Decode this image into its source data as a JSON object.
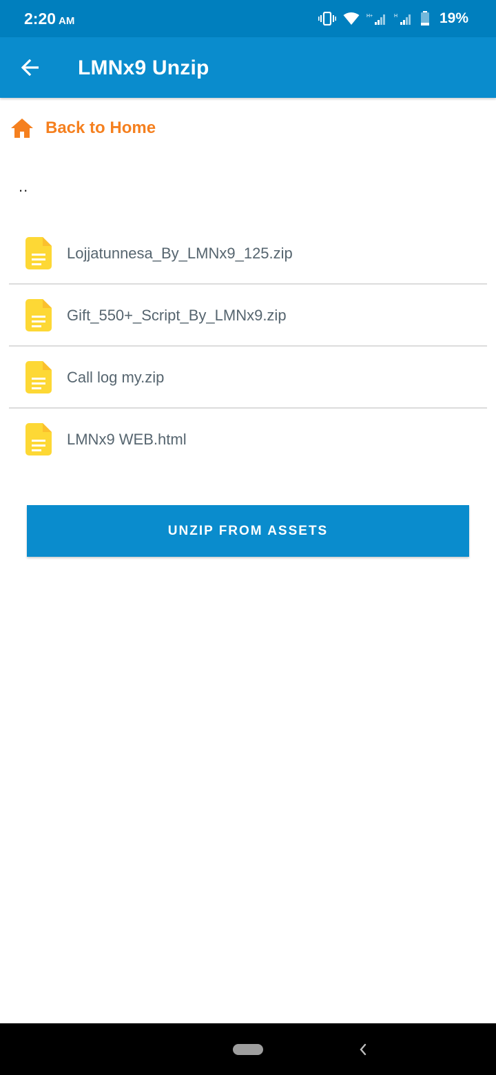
{
  "status_bar": {
    "time": "2:20",
    "ampm": "AM",
    "battery": "19%",
    "icons": [
      "vibrate-icon",
      "wifi-icon",
      "signal-h-plus-icon",
      "signal-h-icon",
      "battery-icon"
    ]
  },
  "app_bar": {
    "title": "LMNx9 Unzip",
    "back_icon": "arrow-left-icon"
  },
  "home_link": {
    "label": "Back to Home",
    "icon": "home-icon",
    "color": "#f5801f"
  },
  "parent_dir": "..",
  "files": [
    {
      "name": "Lojjatunnesa_By_LMNx9_125.zip",
      "icon": "file-icon"
    },
    {
      "name": "Gift_550+_Script_By_LMNx9.zip",
      "icon": "file-icon"
    },
    {
      "name": "Call log my.zip",
      "icon": "file-icon"
    },
    {
      "name": "LMNx9 WEB.html",
      "icon": "file-icon"
    }
  ],
  "unzip_button": {
    "label": "UNZIP FROM ASSETS"
  },
  "colors": {
    "status_bar": "#007fbe",
    "app_bar": "#0a8ccd",
    "accent": "#f5801f",
    "file_icon": "#fdd835",
    "file_text": "#56656f"
  }
}
